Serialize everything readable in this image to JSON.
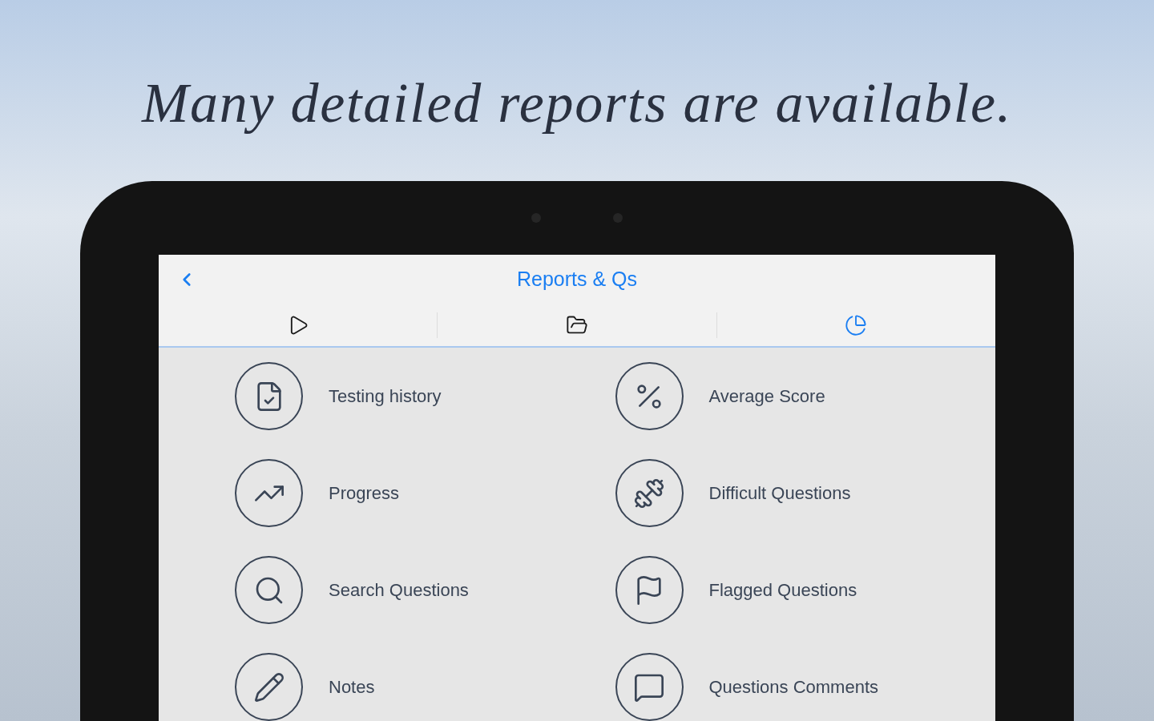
{
  "headline": "Many detailed reports are available.",
  "screen": {
    "title": "Reports & Qs",
    "tabs": [
      {
        "kind": "play",
        "selected": false
      },
      {
        "kind": "folder",
        "selected": false
      },
      {
        "kind": "chart",
        "selected": true
      }
    ],
    "items": [
      {
        "label": "Testing history",
        "kind": "history"
      },
      {
        "label": "Average Score",
        "kind": "percent"
      },
      {
        "label": "Progress",
        "kind": "progress"
      },
      {
        "label": "Difficult Questions",
        "kind": "difficult"
      },
      {
        "label": "Search Questions",
        "kind": "search"
      },
      {
        "label": "Flagged Questions",
        "kind": "flag"
      },
      {
        "label": "Notes",
        "kind": "notes"
      },
      {
        "label": "Questions Comments",
        "kind": "comments"
      }
    ]
  }
}
